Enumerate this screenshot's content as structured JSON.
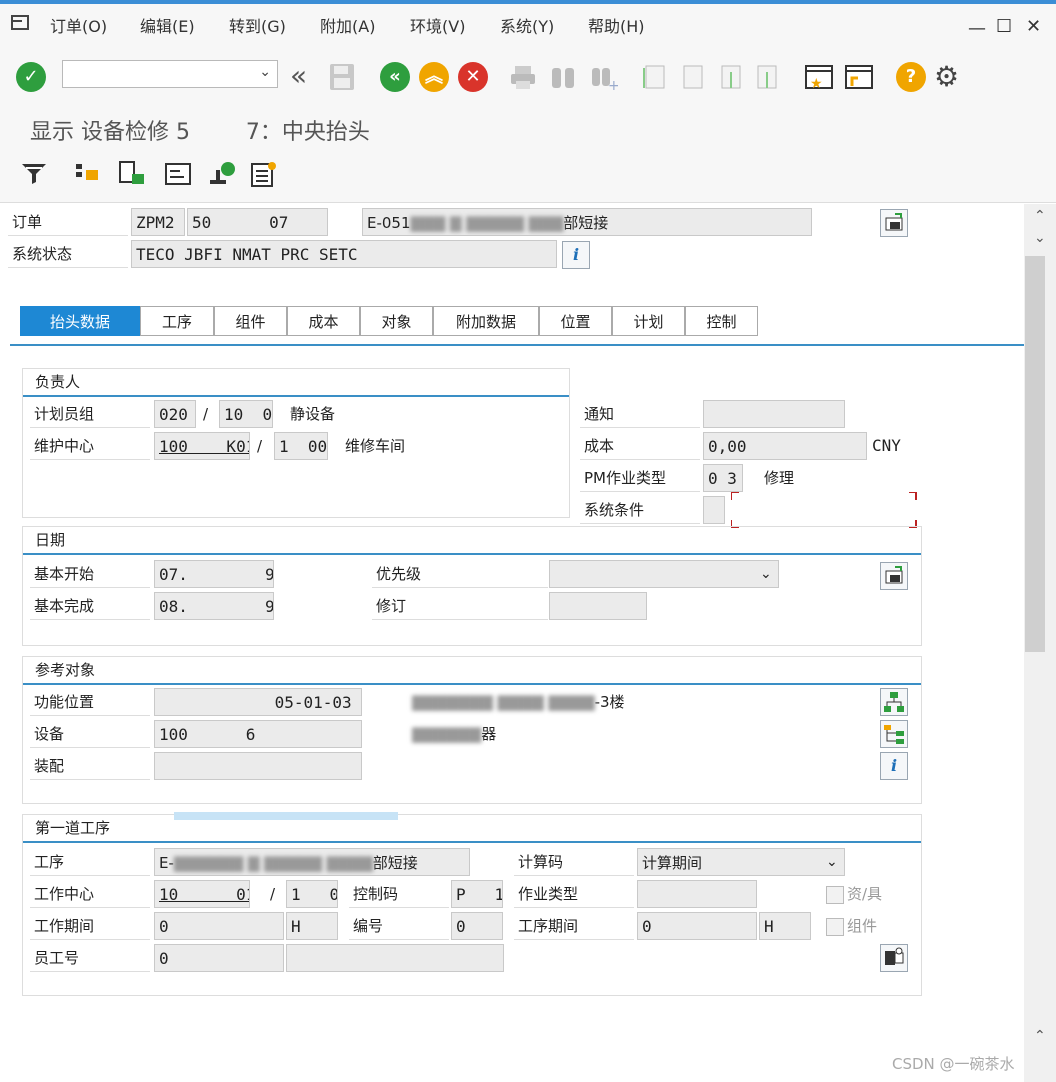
{
  "menu": [
    "订单(O)",
    "编辑(E)",
    "转到(G)",
    "附加(A)",
    "环境(V)",
    "系统(Y)",
    "帮助(H)"
  ],
  "window_buttons": [
    "—",
    "☐",
    "✕"
  ],
  "title": "显示 设备检修 5        7：中央抬头",
  "header": {
    "order_label": "订单",
    "order_type": "ZPM2",
    "order_number": "50      07",
    "order_desc_prefix": "E-051",
    "order_desc_suffix": "部短接",
    "status_label": "系统状态",
    "status_value": "TECO JBFI NMAT PRC  SETC"
  },
  "tabs": [
    "抬头数据",
    "工序",
    "组件",
    "成本",
    "对象",
    "附加数据",
    "位置",
    "计划",
    "控制"
  ],
  "responsible": {
    "title": "负责人",
    "planner_label": "计划员组",
    "planner_group": "020",
    "planner_plant": "10  0",
    "planner_text": "静设备",
    "workcenter_label": "维护中心",
    "workcenter": "100    K01",
    "workcenter_plant": "1  00",
    "workcenter_text": "维修车间"
  },
  "right_info": {
    "notice_label": "通知",
    "notice_value": "",
    "cost_label": "成本",
    "cost_value": "0,00",
    "cost_currency": "CNY",
    "pm_type_label": "PM作业类型",
    "pm_type_value": "0 3",
    "pm_type_text": "修理",
    "sys_cond_label": "系统条件",
    "sys_cond_value": ""
  },
  "dates": {
    "title": "日期",
    "basic_start_label": "基本开始",
    "basic_start": "07.        9",
    "basic_finish_label": "基本完成",
    "basic_finish": "08.        9",
    "priority_label": "优先级",
    "priority_value": "",
    "revision_label": "修订",
    "revision_value": ""
  },
  "reference": {
    "title": "参考对象",
    "func_loc_label": "功能位置",
    "func_loc": "            05-01-03",
    "func_loc_text": "-3楼",
    "equipment_label": "设备",
    "equipment": "100      6",
    "equipment_text": "器",
    "assembly_label": "装配",
    "assembly": ""
  },
  "first_op": {
    "title": "第一道工序",
    "op_label": "工序",
    "op_desc_prefix": "E-",
    "op_desc_suffix": "部短接",
    "calc_key_label": "计算码",
    "calc_key": "计算期间",
    "workcenter_label": "工作中心",
    "workcenter": "10      01",
    "workcenter_plant": "1   0",
    "control_key_label": "控制码",
    "control_key": "P   1",
    "activity_type_label": "作业类型",
    "activity_type": "",
    "resources_label": "资/具",
    "work_period_label": "工作期间",
    "work_period": "0",
    "work_unit": "H",
    "number_label": "编号",
    "number": "0",
    "op_duration_label": "工序期间",
    "op_duration": "0",
    "op_unit": "H",
    "components_label": "组件",
    "personnel_label": "员工号",
    "personnel": "0"
  },
  "watermark": "CSDN @一碗茶水"
}
